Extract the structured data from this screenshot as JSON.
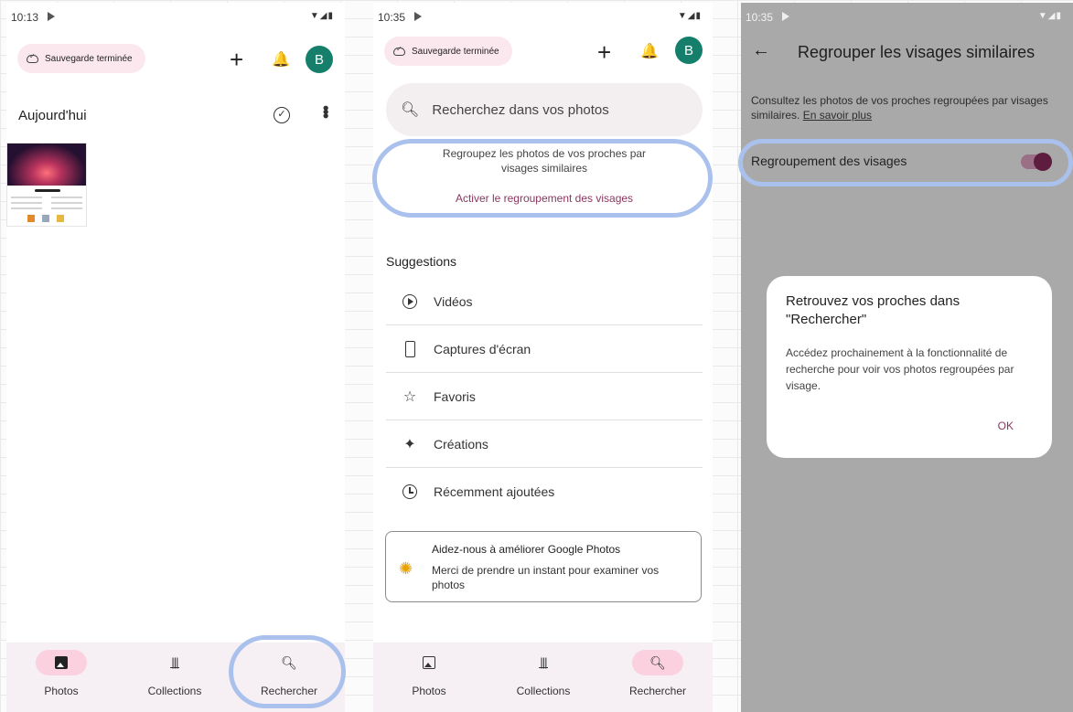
{
  "screen1": {
    "status_time": "10:13",
    "status_icons": "▼◢▮",
    "backup_chip": "Sauvegarde terminée",
    "add_symbol": "+",
    "bell_symbol": "🔔",
    "avatar_letter": "B",
    "today_label": "Aujourd'hui",
    "select_symbol": "✓",
    "more_symbol": "•••",
    "nav": [
      {
        "label": "Photos",
        "icon": "photo-icon",
        "active": true
      },
      {
        "label": "Collections",
        "icon": "collections-icon",
        "active": false
      },
      {
        "label": "Rechercher",
        "icon": "search-icon",
        "active": false
      }
    ]
  },
  "screen2": {
    "status_time": "10:35",
    "status_icons": "▼◢▮",
    "backup_chip": "Sauvegarde terminée",
    "add_symbol": "+",
    "bell_symbol": "🔔",
    "avatar_letter": "B",
    "search_placeholder": "Recherchez dans vos photos",
    "face_prompt_text": "Regroupez les photos de vos proches par visages similaires",
    "face_prompt_action": "Activer le regroupement des visages",
    "suggestions_title": "Suggestions",
    "suggestions": [
      {
        "label": "Vidéos",
        "icon": "video-icon"
      },
      {
        "label": "Captures d'écran",
        "icon": "screenshot-icon"
      },
      {
        "label": "Favoris",
        "icon": "star-icon"
      },
      {
        "label": "Créations",
        "icon": "sparkle-icon"
      },
      {
        "label": "Récemment ajoutées",
        "icon": "clock-icon"
      }
    ],
    "feedback_title": "Aidez-nous à améliorer Google Photos",
    "feedback_body": "Merci de prendre un instant pour examiner vos photos",
    "nav": [
      {
        "label": "Photos",
        "icon": "photo-icon",
        "active": false
      },
      {
        "label": "Collections",
        "icon": "collections-icon",
        "active": false
      },
      {
        "label": "Rechercher",
        "icon": "search-icon",
        "active": true
      }
    ]
  },
  "screen3": {
    "status_time": "10:35",
    "status_icons": "▼◢▮",
    "back_symbol": "←",
    "title": "Regrouper les visages similaires",
    "description": "Consultez les photos de vos proches regroupées par visages similaires.",
    "learn_more": "En savoir plus",
    "toggle_label": "Regroupement des visages",
    "toggle_on": true,
    "dialog_title": "Retrouvez vos proches dans \"Rechercher\"",
    "dialog_body": "Accédez prochainement à la fonctionnalité de recherche pour voir vos photos regroupées par visage.",
    "dialog_ok": "OK"
  },
  "colors": {
    "accent": "#8a3760",
    "highlight_ring": "#a9c1ec",
    "avatar_bg": "#167f6b",
    "nav_active": "#fbd1e0"
  }
}
